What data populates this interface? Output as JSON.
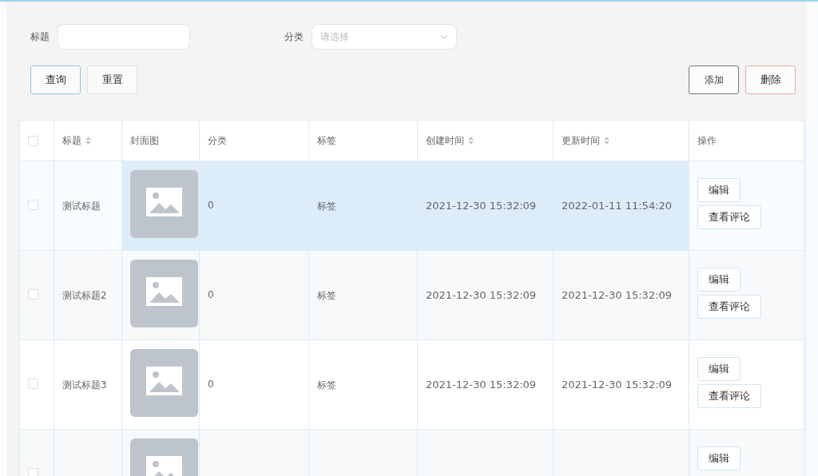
{
  "filters": [
    {
      "label": "标题",
      "kind": "input"
    },
    {
      "label": "分类",
      "kind": "select",
      "placeholder": "请选择"
    }
  ],
  "actions_left": [
    {
      "label": "查询",
      "kind": "primary"
    },
    {
      "label": "重置",
      "kind": "plain"
    }
  ],
  "actions_right": [
    {
      "label": "添加",
      "kind": "dark"
    },
    {
      "label": "删除",
      "kind": "danger"
    }
  ],
  "table": {
    "header_checked": false,
    "columns": [
      {
        "label": "标题",
        "sortable": true
      },
      {
        "label": "封面图",
        "sortable": false
      },
      {
        "label": "分类",
        "sortable": false
      },
      {
        "label": "标签",
        "sortable": false
      },
      {
        "label": "创建时间",
        "sortable": true
      },
      {
        "label": "更新时间",
        "sortable": true
      },
      {
        "label": "操作",
        "sortable": false
      }
    ],
    "rows": [
      {
        "checked": false,
        "highlighted": true,
        "title": "测试标题",
        "category": "0",
        "tag": "标签",
        "created": "2021-12-30 15:32:09",
        "updated": "2022-01-11 11:54:20",
        "actions": [
          "编辑",
          "查看评论"
        ]
      },
      {
        "checked": false,
        "highlighted": false,
        "title": "测试标题2",
        "category": "0",
        "tag": "标签",
        "created": "2021-12-30 15:32:09",
        "updated": "2021-12-30 15:32:09",
        "actions": [
          "编辑",
          "查看评论"
        ]
      },
      {
        "checked": false,
        "highlighted": false,
        "title": "测试标题3",
        "category": "0",
        "tag": "标签",
        "created": "2021-12-30 15:32:09",
        "updated": "2021-12-30 15:32:09",
        "actions": [
          "编辑",
          "查看评论"
        ]
      },
      {
        "checked": false,
        "highlighted": false,
        "actions": [
          "编辑"
        ]
      }
    ]
  }
}
